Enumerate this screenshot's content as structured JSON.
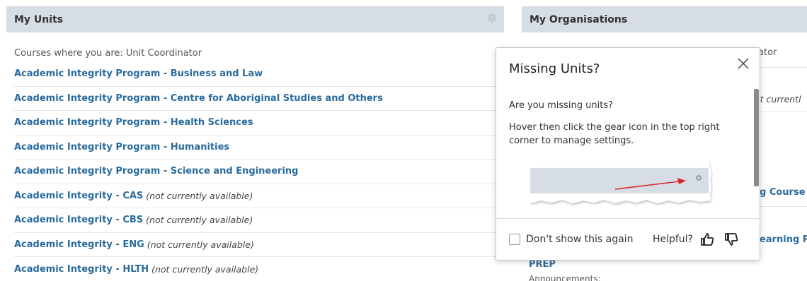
{
  "my_units": {
    "title": "My Units",
    "section_label": "Courses where you are: Unit Coordinator",
    "units": [
      {
        "name": "Academic Integrity Program - Business and Law",
        "status": ""
      },
      {
        "name": "Academic Integrity Program - Centre for Aboriginal Studies and Others",
        "status": ""
      },
      {
        "name": "Academic Integrity Program - Health Sciences",
        "status": ""
      },
      {
        "name": "Academic Integrity Program - Humanities",
        "status": ""
      },
      {
        "name": "Academic Integrity Program - Science and Engineering",
        "status": ""
      },
      {
        "name": "Academic Integrity - CAS",
        "status": "(not currently available)"
      },
      {
        "name": "Academic Integrity - CBS",
        "status": "(not currently available)"
      },
      {
        "name": "Academic Integrity - ENG",
        "status": "(not currently available)"
      },
      {
        "name": "Academic Integrity - HLTH",
        "status": "(not currently available)"
      }
    ]
  },
  "my_organisations": {
    "title": "My Organisations",
    "frag_coordinator": "ator",
    "frag_availability": "ot currentl",
    "frag_course": "g Course",
    "frag_learning": "earning P",
    "prep": "PREP",
    "announcements": "Announcements:"
  },
  "popover": {
    "title": "Missing Units?",
    "body_1": "Are you missing units?",
    "body_2": "Hover then click the gear icon in the top right corner to manage settings.",
    "dont_show_label": "Don't show this again",
    "helpful_label": "Helpful?"
  },
  "icons": {
    "gear": "gear-icon",
    "close": "close-icon",
    "thumbs_up": "thumbs-up-icon",
    "thumbs_down": "thumbs-down-icon"
  },
  "colors": {
    "header_bg": "#d7dde5",
    "link": "#2a6b9e",
    "arrow": "#d9282f"
  }
}
